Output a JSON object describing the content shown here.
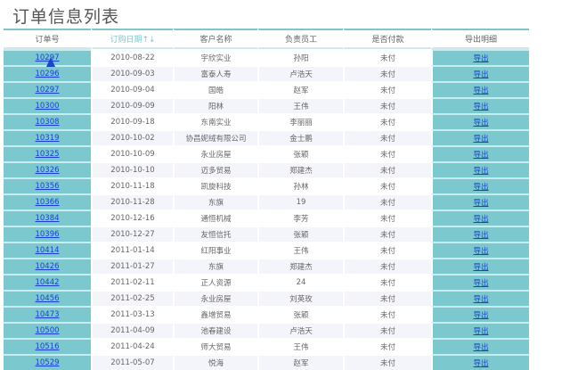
{
  "title": "订单信息列表",
  "headers": [
    "订单号",
    "订购日期↑↓",
    "客户名称",
    "负责员工",
    "是否付款",
    "导出明细"
  ],
  "export_label": "导出",
  "colors": {
    "accent": "#7cc8cf",
    "link": "#1a3fd6",
    "row_alt": "#f3f5fa"
  },
  "rows": [
    {
      "id": "10297",
      "date": "2010-08-22",
      "customer": "宇欣实业",
      "employee": "孙阳",
      "paid": "未付"
    },
    {
      "id": "10296",
      "date": "2010-09-03",
      "customer": "富泰人寿",
      "employee": "卢浩天",
      "paid": "未付"
    },
    {
      "id": "10297",
      "date": "2010-09-04",
      "customer": "国皓",
      "employee": "赵军",
      "paid": "未付"
    },
    {
      "id": "10300",
      "date": "2010-09-09",
      "customer": "阳林",
      "employee": "王伟",
      "paid": "未付"
    },
    {
      "id": "10308",
      "date": "2010-09-18",
      "customer": "东南实业",
      "employee": "李丽丽",
      "paid": "未付"
    },
    {
      "id": "10319",
      "date": "2010-10-02",
      "customer": "协昌妮绒有限公司",
      "employee": "金士鹏",
      "paid": "未付"
    },
    {
      "id": "10325",
      "date": "2010-10-09",
      "customer": "永业房屋",
      "employee": "张颖",
      "paid": "未付"
    },
    {
      "id": "10326",
      "date": "2010-10-10",
      "customer": "迈多贸易",
      "employee": "郑建杰",
      "paid": "未付"
    },
    {
      "id": "10356",
      "date": "2010-11-18",
      "customer": "凯旋科技",
      "employee": "孙林",
      "paid": "未付"
    },
    {
      "id": "10366",
      "date": "2010-11-28",
      "customer": "东旗",
      "employee": "19",
      "paid": "未付"
    },
    {
      "id": "10384",
      "date": "2010-12-16",
      "customer": "通恒机械",
      "employee": "李芳",
      "paid": "未付"
    },
    {
      "id": "10396",
      "date": "2010-12-27",
      "customer": "友恒信托",
      "employee": "张颖",
      "paid": "未付"
    },
    {
      "id": "10414",
      "date": "2011-01-14",
      "customer": "红阳事业",
      "employee": "王伟",
      "paid": "未付"
    },
    {
      "id": "10426",
      "date": "2011-01-27",
      "customer": "东旗",
      "employee": "郑建杰",
      "paid": "未付"
    },
    {
      "id": "10442",
      "date": "2011-02-11",
      "customer": "正人资源",
      "employee": "24",
      "paid": "未付"
    },
    {
      "id": "10456",
      "date": "2011-02-25",
      "customer": "永业房屋",
      "employee": "刘英玫",
      "paid": "未付"
    },
    {
      "id": "10473",
      "date": "2011-03-13",
      "customer": "鑫增贸易",
      "employee": "张颖",
      "paid": "未付"
    },
    {
      "id": "10500",
      "date": "2011-04-09",
      "customer": "池春建设",
      "employee": "卢浩天",
      "paid": "未付"
    },
    {
      "id": "10516",
      "date": "2011-04-24",
      "customer": "师大贸易",
      "employee": "王伟",
      "paid": "未付"
    },
    {
      "id": "10529",
      "date": "2011-05-07",
      "customer": "悦海",
      "employee": "赵军",
      "paid": "未付"
    }
  ]
}
